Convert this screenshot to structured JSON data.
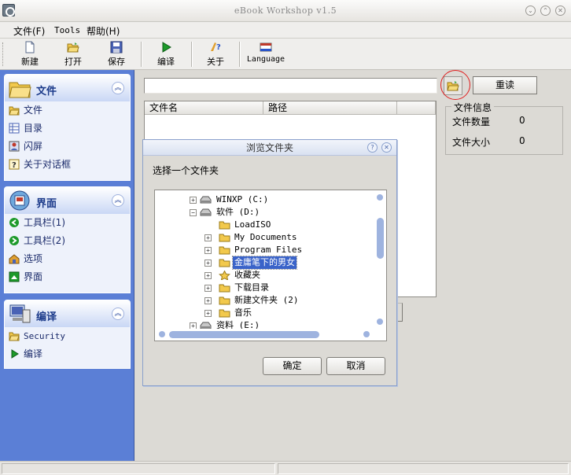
{
  "window": {
    "title": "eBook Workshop v1.5",
    "controls": [
      "⌄",
      "⌃",
      "✕"
    ]
  },
  "menubar": {
    "items": [
      "文件(F)",
      "Tools",
      "帮助(H)"
    ]
  },
  "toolbar": {
    "buttons": [
      {
        "label": "新建",
        "icon": "new-file-icon"
      },
      {
        "label": "打开",
        "icon": "open-folder-icon"
      },
      {
        "label": "保存",
        "icon": "save-disk-icon"
      },
      {
        "label": "编译",
        "icon": "compile-play-icon"
      },
      {
        "label": "关于",
        "icon": "about-help-icon"
      },
      {
        "label": "Language",
        "icon": "language-flag-icon"
      }
    ]
  },
  "sidebar": {
    "panels": [
      {
        "title": "文件",
        "icon": "folder-icon",
        "items": [
          {
            "label": "文件",
            "icon": "open-folder-icon"
          },
          {
            "label": "目录",
            "icon": "table-icon"
          },
          {
            "label": "闪屏",
            "icon": "splash-image-icon"
          },
          {
            "label": "关于对话框",
            "icon": "help-dialog-icon"
          }
        ]
      },
      {
        "title": "界面",
        "icon": "interface-icon",
        "items": [
          {
            "label": "工具栏(1)",
            "icon": "arrow-left-icon"
          },
          {
            "label": "工具栏(2)",
            "icon": "arrow-right-icon"
          },
          {
            "label": "选项",
            "icon": "options-icon"
          },
          {
            "label": "界面",
            "icon": "window-icon"
          }
        ]
      },
      {
        "title": "编译",
        "icon": "computer-icon",
        "items": [
          {
            "label": "Security",
            "icon": "open-folder-icon"
          },
          {
            "label": "编译",
            "icon": "play-icon"
          }
        ]
      }
    ],
    "collapse_glyph": "︽"
  },
  "main": {
    "path_value": "",
    "reload_label": "重读",
    "table_headers": [
      "文件名",
      "路径"
    ],
    "info": {
      "legend": "文件信息",
      "rows": [
        {
          "label": "文件数量",
          "value": "0"
        },
        {
          "label": "文件大小",
          "value": "0"
        }
      ]
    }
  },
  "dialog": {
    "title": "浏览文件夹",
    "prompt": "选择一个文件夹",
    "tree": [
      {
        "label": "WINXP (C:)",
        "type": "drive",
        "expander": "+",
        "level": 0
      },
      {
        "label": "软件 (D:)",
        "type": "drive",
        "expander": "−",
        "level": 0
      },
      {
        "label": "LoadISO",
        "type": "folder",
        "expander": "",
        "level": 1
      },
      {
        "label": "My Documents",
        "type": "folder",
        "expander": "+",
        "level": 1
      },
      {
        "label": "Program Files",
        "type": "folder",
        "expander": "+",
        "level": 1
      },
      {
        "label": "金庸笔下的男女",
        "type": "folder",
        "expander": "+",
        "level": 1,
        "selected": true
      },
      {
        "label": "收藏夹",
        "type": "star",
        "expander": "+",
        "level": 1
      },
      {
        "label": "下载目录",
        "type": "folder",
        "expander": "+",
        "level": 1
      },
      {
        "label": "新建文件夹 (2)",
        "type": "folder",
        "expander": "+",
        "level": 1
      },
      {
        "label": "音乐",
        "type": "folder",
        "expander": "+",
        "level": 1
      },
      {
        "label": "资料 (E:)",
        "type": "drive",
        "expander": "+",
        "level": 0
      }
    ],
    "ok_label": "确定",
    "cancel_label": "取消"
  },
  "colors": {
    "sidebar_bg": "#5b7fd6",
    "selection": "#3a63c9",
    "highlight_circle": "#e02020"
  }
}
